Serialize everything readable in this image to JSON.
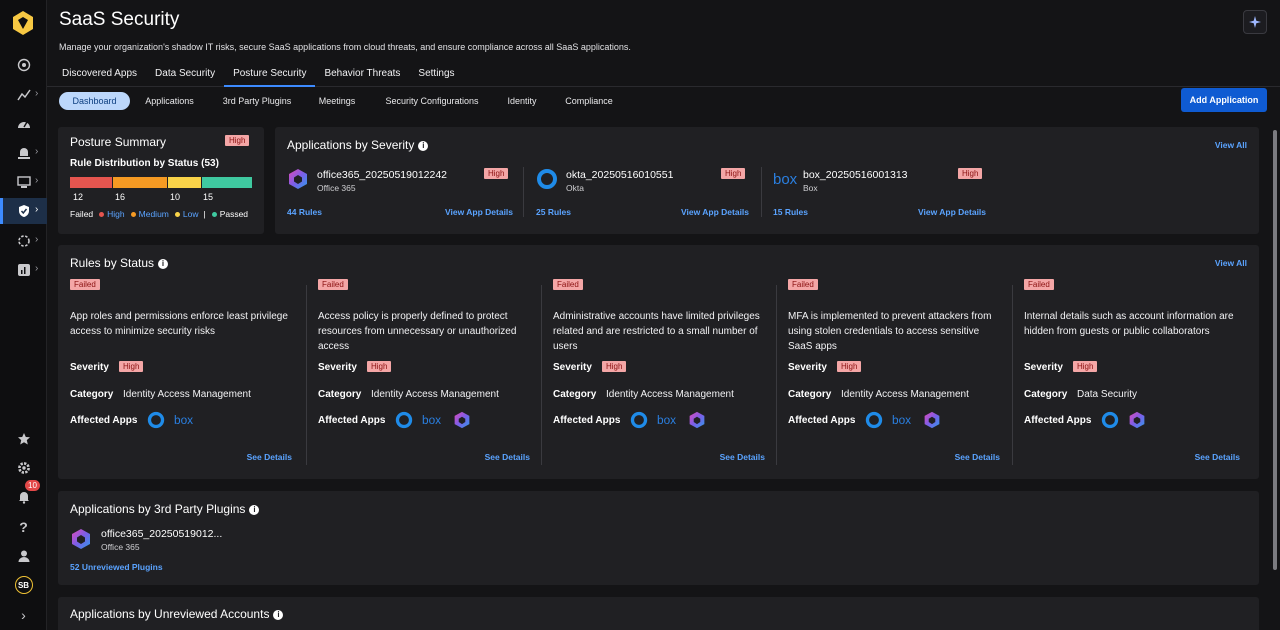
{
  "app": {
    "title": "SaaS Security",
    "subtitle": "Manage your organization's shadow IT risks, secure SaaS applications from cloud threats, and ensure compliance across all SaaS applications."
  },
  "tabs": [
    "Discovered Apps",
    "Data Security",
    "Posture Security",
    "Behavior Threats",
    "Settings"
  ],
  "active_tab": "Posture Security",
  "subnav": {
    "items": [
      "Dashboard",
      "Applications",
      "3rd Party Plugins",
      "Meetings",
      "Security Configurations",
      "Identity",
      "Compliance"
    ],
    "active": "Dashboard",
    "add_button": "Add Application"
  },
  "rail": {
    "notification_count": "10",
    "avatar_initials": "SB"
  },
  "posture_summary": {
    "title": "Posture Summary",
    "severity": "High",
    "dist_label": "Rule Distribution by Status",
    "dist_count": "(53)",
    "counts": [
      "12",
      "16",
      "10",
      "15"
    ],
    "colors": [
      "#e5554f",
      "#f59a23",
      "#f9d349",
      "#3fc9a0"
    ],
    "legend": {
      "failed": "Failed",
      "high": "High",
      "medium": "Medium",
      "low": "Low",
      "sep": "|",
      "passed": "Passed"
    }
  },
  "apps_by_severity": {
    "title": "Applications by Severity",
    "view_all": "View All",
    "apps": [
      {
        "name": "office365_20250519012242",
        "type": "Office 365",
        "severity": "High",
        "rules": "44 Rules",
        "details": "View App Details",
        "icon": "office365-icon"
      },
      {
        "name": "okta_20250516010551",
        "type": "Okta",
        "severity": "High",
        "rules": "25 Rules",
        "details": "View App Details",
        "icon": "okta-icon"
      },
      {
        "name": "box_20250516001313",
        "type": "Box",
        "severity": "High",
        "rules": "15 Rules",
        "details": "View App Details",
        "icon": "box-icon"
      }
    ]
  },
  "rules_by_status": {
    "title": "Rules by Status",
    "view_all": "View All",
    "severity_label": "Severity",
    "category_label": "Category",
    "affected_label": "Affected Apps",
    "rules": [
      {
        "status": "Failed",
        "text": "App roles and permissions enforce least privilege access to minimize security risks",
        "severity": "High",
        "category": "Identity Access Management",
        "apps": [
          "okta-icon",
          "box-icon"
        ],
        "details": "See Details"
      },
      {
        "status": "Failed",
        "text": "Access policy is properly defined to protect resources from unnecessary or unauthorized access",
        "severity": "High",
        "category": "Identity Access Management",
        "apps": [
          "okta-icon",
          "box-icon",
          "office365-icon"
        ],
        "details": "See Details"
      },
      {
        "status": "Failed",
        "text": "Administrative accounts have limited privileges related and are restricted to a small number of users",
        "severity": "High",
        "category": "Identity Access Management",
        "apps": [
          "okta-icon",
          "box-icon",
          "office365-icon"
        ],
        "details": "See Details"
      },
      {
        "status": "Failed",
        "text": "MFA is implemented to prevent attackers from using stolen credentials to access sensitive SaaS apps",
        "severity": "High",
        "category": "Identity Access Management",
        "apps": [
          "okta-icon",
          "box-icon",
          "office365-icon"
        ],
        "details": "See Details"
      },
      {
        "status": "Failed",
        "text": "Internal details such as account information are hidden from guests or public collaborators",
        "severity": "High",
        "category": "Data Security",
        "apps": [
          "okta-icon",
          "office365-icon"
        ],
        "details": "See Details"
      }
    ]
  },
  "plugins": {
    "title": "Applications by 3rd Party Plugins",
    "app_name": "office365_20250519012...",
    "app_type": "Office 365",
    "unreviewed": "52 Unreviewed Plugins"
  },
  "unreviewed_accounts": {
    "title": "Applications by Unreviewed Accounts"
  }
}
